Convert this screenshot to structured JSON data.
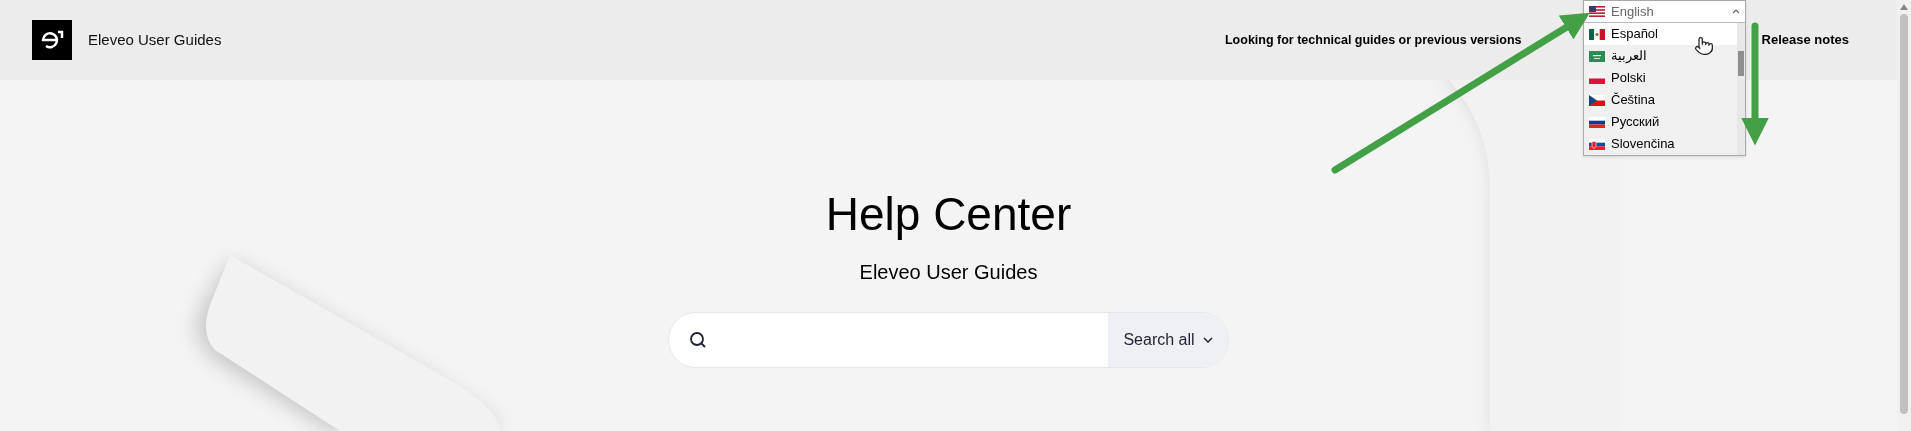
{
  "header": {
    "title": "Eleveo User Guides",
    "notice": "Looking for technical guides or previous versions",
    "link": "Release notes"
  },
  "language_select": {
    "value": "English",
    "expanded": true,
    "options": [
      {
        "label": "Español",
        "selected": true
      },
      {
        "label": "العربية",
        "selected": false
      },
      {
        "label": "Polski",
        "selected": false
      },
      {
        "label": "Čeština",
        "selected": false
      },
      {
        "label": "Русский",
        "selected": false
      },
      {
        "label": "Slovenčina",
        "selected": false
      }
    ]
  },
  "hero": {
    "title": "Help Center",
    "subtitle": "Eleveo User Guides"
  },
  "search": {
    "scope": "Search all"
  }
}
